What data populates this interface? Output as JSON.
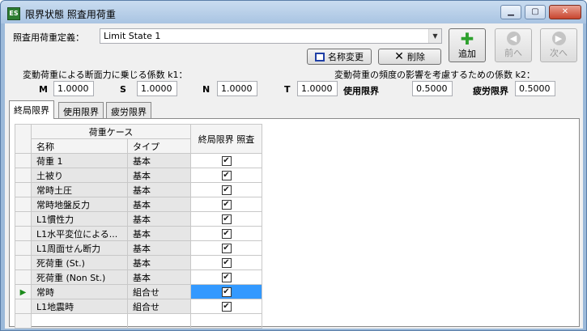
{
  "window": {
    "title": "限界状態 照査用荷重",
    "app_icon": "app-icon"
  },
  "definition": {
    "label": "照査用荷重定義：",
    "value": "Limit State 1"
  },
  "buttons": {
    "rename": "名称変更",
    "delete": "削除",
    "add": "追加",
    "prev": "前へ",
    "next": "次へ"
  },
  "coefficients": {
    "k1_label": "変動荷重による断面力に乗じる係数 k1：",
    "k2_label": "変動荷重の頻度の影響を考慮するための係数 k2：",
    "m_label": "M",
    "m_value": "1.0000",
    "s_label": "S",
    "s_value": "1.0000",
    "n_label": "N",
    "n_value": "1.0000",
    "t_label": "T",
    "t_value": "1.0000",
    "service_label": "使用限界",
    "service_value": "0.5000",
    "fatigue_label": "疲労限界",
    "fatigue_value": "0.5000"
  },
  "tabs": [
    "終局限界",
    "使用限界",
    "疲労限界"
  ],
  "active_tab": 0,
  "table": {
    "group_header": "荷重ケース",
    "col_name": "名称",
    "col_type": "タイプ",
    "col_check": "終局限界 照査",
    "rows": [
      {
        "name": "荷重 1",
        "type": "基本",
        "checked": true
      },
      {
        "name": "土被り",
        "type": "基本",
        "checked": true
      },
      {
        "name": "常時土圧",
        "type": "基本",
        "checked": true
      },
      {
        "name": "常時地盤反力",
        "type": "基本",
        "checked": true
      },
      {
        "name": "L1慣性力",
        "type": "基本",
        "checked": true
      },
      {
        "name": "L1水平変位による...",
        "type": "基本",
        "checked": true
      },
      {
        "name": "L1周面せん断力",
        "type": "基本",
        "checked": true
      },
      {
        "name": "死荷重 (St.)",
        "type": "基本",
        "checked": true
      },
      {
        "name": "死荷重 (Non St.)",
        "type": "基本",
        "checked": true
      },
      {
        "name": "常時",
        "type": "組合せ",
        "checked": true,
        "selected": true
      },
      {
        "name": "L1地震時",
        "type": "組合せ",
        "checked": true
      }
    ]
  },
  "colors": {
    "selection": "#3399ff",
    "add_icon": "#2ea12e",
    "row_arrow": "#1c8b1c"
  }
}
